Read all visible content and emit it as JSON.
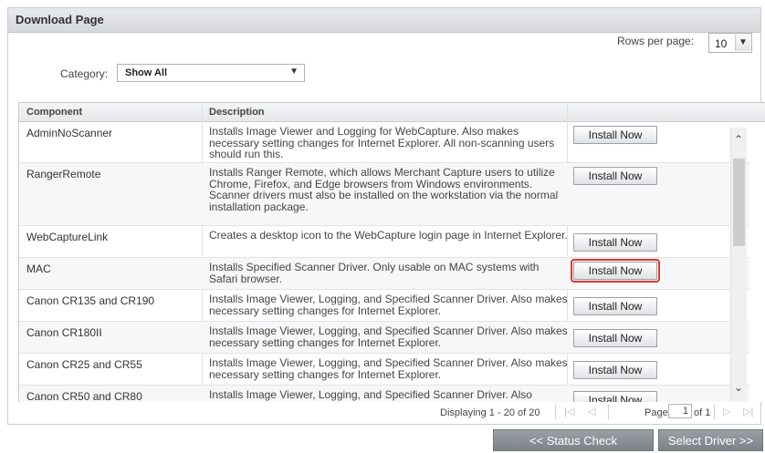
{
  "panel": {
    "title": "Download Page"
  },
  "rows_per_page": {
    "label": "Rows per page:",
    "value": "10"
  },
  "category": {
    "label": "Category:",
    "value": "Show All"
  },
  "table": {
    "headers": {
      "component": "Component",
      "description": "Description"
    },
    "button_label": "Install Now",
    "rows": [
      {
        "component": "AdminNoScanner",
        "description": "Installs Image Viewer and Logging for WebCapture. Also makes necessary setting changes for Internet Explorer. All non-scanning users should run this."
      },
      {
        "component": "RangerRemote",
        "description": "Installs Ranger Remote, which allows Merchant Capture users to utilize Chrome, Firefox, and Edge browsers from Windows environments. Scanner drivers must also be installed on the workstation via the normal installation package."
      },
      {
        "component": "WebCaptureLink",
        "description": "Creates a desktop icon to the WebCapture login page in Internet Explorer."
      },
      {
        "component": "MAC",
        "description": "Installs Specified Scanner Driver. Only usable on MAC systems with Safari browser."
      },
      {
        "component": "Canon CR135 and CR190",
        "description": "Installs Image Viewer, Logging, and Specified Scanner Driver. Also makes necessary setting changes for Internet Explorer."
      },
      {
        "component": "Canon CR180II",
        "description": "Installs Image Viewer, Logging, and Specified Scanner Driver. Also makes necessary setting changes for Internet Explorer."
      },
      {
        "component": "Canon CR25 and CR55",
        "description": "Installs Image Viewer, Logging, and Specified Scanner Driver. Also makes necessary setting changes for Internet Explorer."
      },
      {
        "component": "Canon CR50 and CR80",
        "description": "Installs Image Viewer, Logging, and Specified Scanner Driver. Also"
      }
    ]
  },
  "pager": {
    "displaying": "Displaying 1 - 20 of 20",
    "page_label": "Page",
    "page_value": "1",
    "of_label": "of 1"
  },
  "actions": {
    "status_check": "<< Status Check",
    "select_driver": "Select Driver >>"
  },
  "icons": {
    "dropdown": "chevron-down-icon",
    "scroll_up": "chevron-up-icon",
    "scroll_down": "chevron-down-icon",
    "first": "first-page-icon",
    "prev": "prev-page-icon",
    "next": "next-page-icon",
    "last": "last-page-icon"
  },
  "colors": {
    "highlight": "#e0392f",
    "action_button": "#8a9096"
  }
}
